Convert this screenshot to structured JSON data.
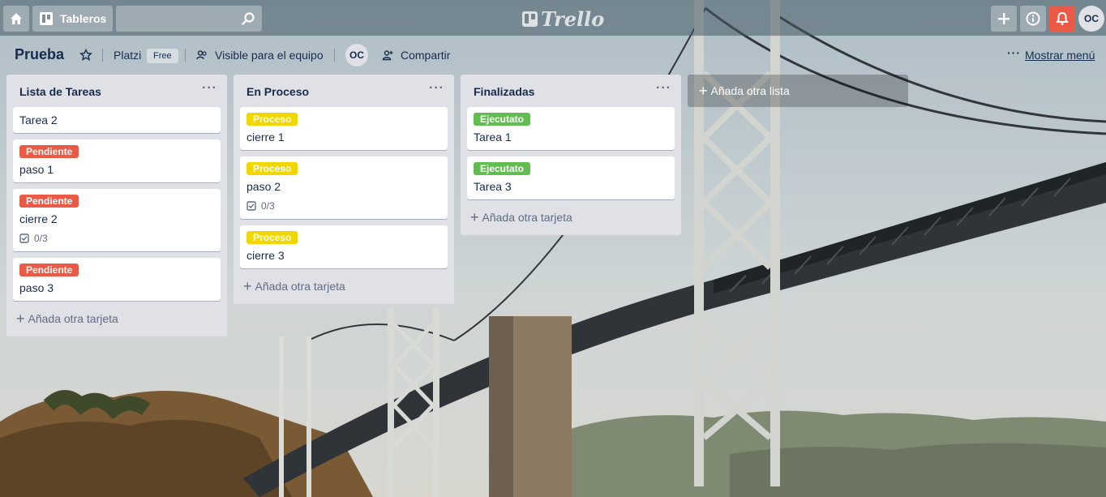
{
  "header": {
    "boards_label": "Tableros",
    "search_placeholder": "",
    "logo_text": "Trello",
    "avatar_initials": "OC",
    "icons": [
      "home-icon",
      "boards-icon",
      "search-icon",
      "plus-icon",
      "info-icon",
      "bell-icon"
    ]
  },
  "board": {
    "title": "Prueba",
    "team": "Platzi",
    "plan": "Free",
    "visibility": "Visible para el equipo",
    "member_initials": "OC",
    "share_label": "Compartir",
    "menu_dots": "···",
    "menu_label": "Mostrar menú"
  },
  "lists": [
    {
      "title": "Lista de Tareas",
      "menu": "···",
      "add_card": "Añada otra tarjeta",
      "cards": [
        {
          "label": "",
          "label_color": "",
          "title": "Tarea 2",
          "checklist": ""
        },
        {
          "label": "Pendiente",
          "label_color": "red",
          "title": "paso 1",
          "checklist": ""
        },
        {
          "label": "Pendiente",
          "label_color": "red",
          "title": "cierre 2",
          "checklist": "0/3"
        },
        {
          "label": "Pendiente",
          "label_color": "red",
          "title": "paso 3",
          "checklist": ""
        }
      ]
    },
    {
      "title": "En Proceso",
      "menu": "···",
      "add_card": "Añada otra tarjeta",
      "cards": [
        {
          "label": "Proceso",
          "label_color": "yellow",
          "title": "cierre 1",
          "checklist": ""
        },
        {
          "label": "Proceso",
          "label_color": "yellow",
          "title": "paso 2",
          "checklist": "0/3"
        },
        {
          "label": "Proceso",
          "label_color": "yellow",
          "title": "cierre 3",
          "checklist": ""
        }
      ]
    },
    {
      "title": "Finalizadas",
      "menu": "···",
      "add_card": "Añada otra tarjeta",
      "cards": [
        {
          "label": "Ejecutato",
          "label_color": "green",
          "title": "Tarea 1",
          "checklist": ""
        },
        {
          "label": "Ejecutato",
          "label_color": "green",
          "title": "Tarea 3",
          "checklist": ""
        }
      ]
    }
  ],
  "add_list_label": "Añada otra lista",
  "colors": {
    "red": "#eb5a46",
    "yellow": "#f2d600",
    "green": "#61bd4f",
    "list_bg": "#dfe1e6",
    "notification_bg": "#eb5a46"
  }
}
